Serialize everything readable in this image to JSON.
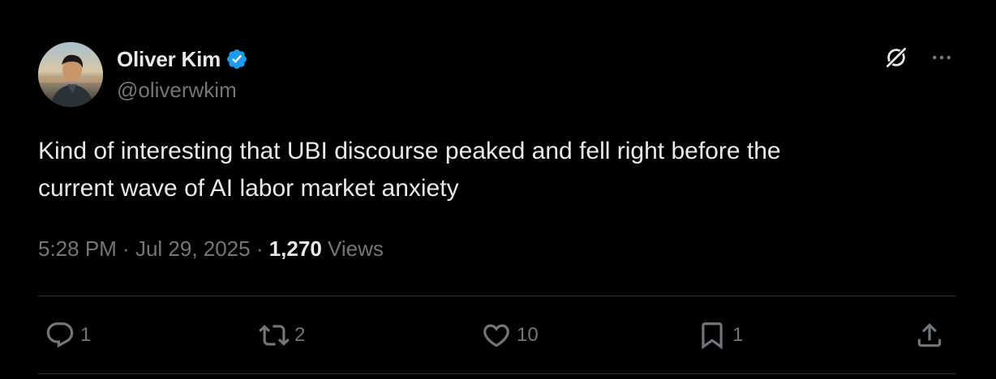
{
  "author": {
    "display_name": "Oliver Kim",
    "handle": "@oliverwkim",
    "verified": true
  },
  "tweet": {
    "text": "Kind of interesting that UBI discourse peaked and fell right before the\ncurrent wave of AI labor market anxiety",
    "time": "5:28 PM",
    "date": "Jul 29, 2025",
    "separator": " · ",
    "views_count": "1,270",
    "views_label": "Views"
  },
  "actions": {
    "replies": "1",
    "reposts": "2",
    "likes": "10",
    "bookmarks": "1"
  },
  "icons": {
    "verified": "verified-badge-icon",
    "grok": "grok-icon",
    "more": "more-icon",
    "reply": "reply-icon",
    "repost": "repost-icon",
    "like": "heart-icon",
    "bookmark": "bookmark-icon",
    "share": "share-icon"
  },
  "colors": {
    "background": "#000000",
    "text_primary": "#e7e9ea",
    "text_secondary": "#71767b",
    "verified_blue": "#1d9bf0",
    "divider": "#2f3336"
  }
}
